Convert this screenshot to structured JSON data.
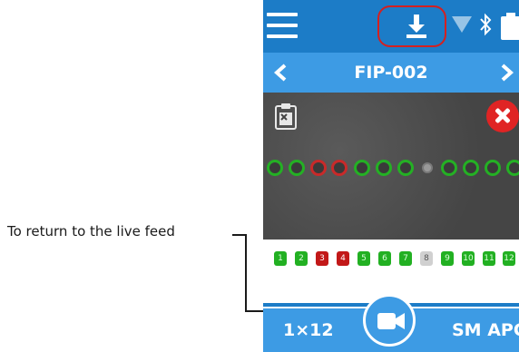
{
  "callout": {
    "text": "To return to the live feed"
  },
  "header": {
    "icons": [
      "menu-icon",
      "download-icon",
      "wifi-icon",
      "bluetooth-icon",
      "battery-icon"
    ],
    "accent_color": "#1c7cc7",
    "highlight_color": "#d42020"
  },
  "nav": {
    "title": "FIP-002",
    "icons": [
      "chevron-left-icon",
      "chevron-right-icon"
    ],
    "color": "#3d9be4"
  },
  "feed": {
    "icons": [
      "report-icon",
      "close-icon"
    ],
    "fibers": [
      "pass",
      "pass",
      "fail",
      "fail",
      "pass",
      "pass",
      "pass",
      "off",
      "pass",
      "pass",
      "pass",
      "pass"
    ]
  },
  "results": {
    "fibers": [
      {
        "label": "1",
        "status": "pass"
      },
      {
        "label": "2",
        "status": "pass"
      },
      {
        "label": "3",
        "status": "fail"
      },
      {
        "label": "4",
        "status": "fail"
      },
      {
        "label": "5",
        "status": "pass"
      },
      {
        "label": "6",
        "status": "pass"
      },
      {
        "label": "7",
        "status": "pass"
      },
      {
        "label": "8",
        "status": "off"
      },
      {
        "label": "9",
        "status": "pass"
      },
      {
        "label": "10",
        "status": "pass"
      },
      {
        "label": "11",
        "status": "pass"
      },
      {
        "label": "12",
        "status": "pass"
      }
    ],
    "colors": {
      "pass": "#22b022",
      "fail": "#c21818",
      "off": "#d0d0d0"
    }
  },
  "bottom": {
    "left_label": "1×12",
    "right_label": "SM APC",
    "center_icon": "video-camera-icon"
  }
}
